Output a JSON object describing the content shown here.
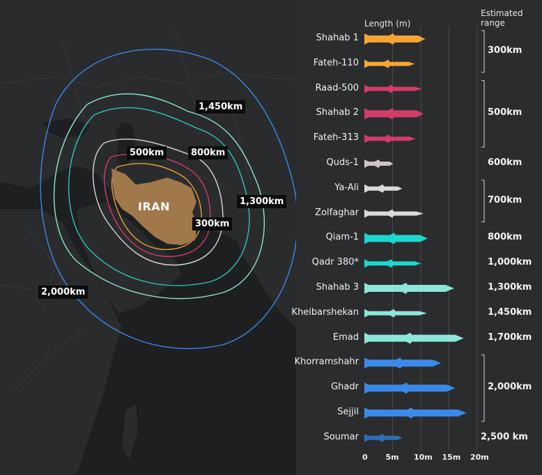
{
  "map": {
    "country_label": "IRAN",
    "country_color": "#a0784a",
    "range_rings": [
      {
        "label": "300km",
        "color": "#e8a23a"
      },
      {
        "label": "500km",
        "color": "#d43c6a"
      },
      {
        "label": "800km",
        "color": "#d9dada"
      },
      {
        "label": "1,300km",
        "color": "#2fc6b8"
      },
      {
        "label": "1,450km",
        "color": "#8ee6d8"
      },
      {
        "label": "2,000km",
        "color": "#3a8ae8"
      }
    ]
  },
  "chart_data": {
    "type": "bar",
    "title": "",
    "xlabel": "Length (m)",
    "range_header": "Estimated range",
    "xlim": [
      0,
      20
    ],
    "ticks": [
      {
        "value": 0,
        "label": "0"
      },
      {
        "value": 5,
        "label": "5m"
      },
      {
        "value": 10,
        "label": "10m"
      },
      {
        "value": 15,
        "label": "15m"
      },
      {
        "value": 20,
        "label": "20m"
      }
    ],
    "categories": [
      "Shahab 1",
      "Fateh-110",
      "Raad-500",
      "Shahab 2",
      "Fateh-313",
      "Quds-1",
      "Ya-Ali",
      "Zolfaghar",
      "Qiam-1",
      "Qadr 380*",
      "Shahab 3",
      "Kheibarshekan",
      "Emad",
      "Khorramshahr",
      "Ghadr",
      "Sejjil",
      "Soumar"
    ],
    "values": [
      10.8,
      8.9,
      10.2,
      10.5,
      9.1,
      5.1,
      6.7,
      10.5,
      11.2,
      10.1,
      15.9,
      11.1,
      17.6,
      13.6,
      16.1,
      18.1,
      6.7
    ],
    "colors": [
      "#f4a531",
      "#f4a531",
      "#d43c6a",
      "#d43c6a",
      "#d43c6a",
      "#cfc2c8",
      "#d9dada",
      "#d9dada",
      "#1bd8d0",
      "#1bd8d0",
      "#8ee6d8",
      "#8ee6d8",
      "#8ee6d8",
      "#3a8ae8",
      "#3a8ae8",
      "#3a8ae8",
      "#2f6db3"
    ],
    "range_groups": [
      {
        "label": "300km",
        "rows": [
          0,
          1
        ]
      },
      {
        "label": "500km",
        "rows": [
          2,
          4
        ]
      },
      {
        "label": "600km",
        "rows": [
          5,
          5
        ]
      },
      {
        "label": "700km",
        "rows": [
          6,
          7
        ]
      },
      {
        "label": "800km",
        "rows": [
          8,
          8
        ]
      },
      {
        "label": "1,000km",
        "rows": [
          9,
          9
        ]
      },
      {
        "label": "1,300km",
        "rows": [
          10,
          10
        ]
      },
      {
        "label": "1,450km",
        "rows": [
          11,
          11
        ]
      },
      {
        "label": "1,700km",
        "rows": [
          12,
          12
        ]
      },
      {
        "label": "2,000km",
        "rows": [
          13,
          15
        ]
      },
      {
        "label": "2,500 km",
        "rows": [
          16,
          16
        ]
      }
    ]
  }
}
